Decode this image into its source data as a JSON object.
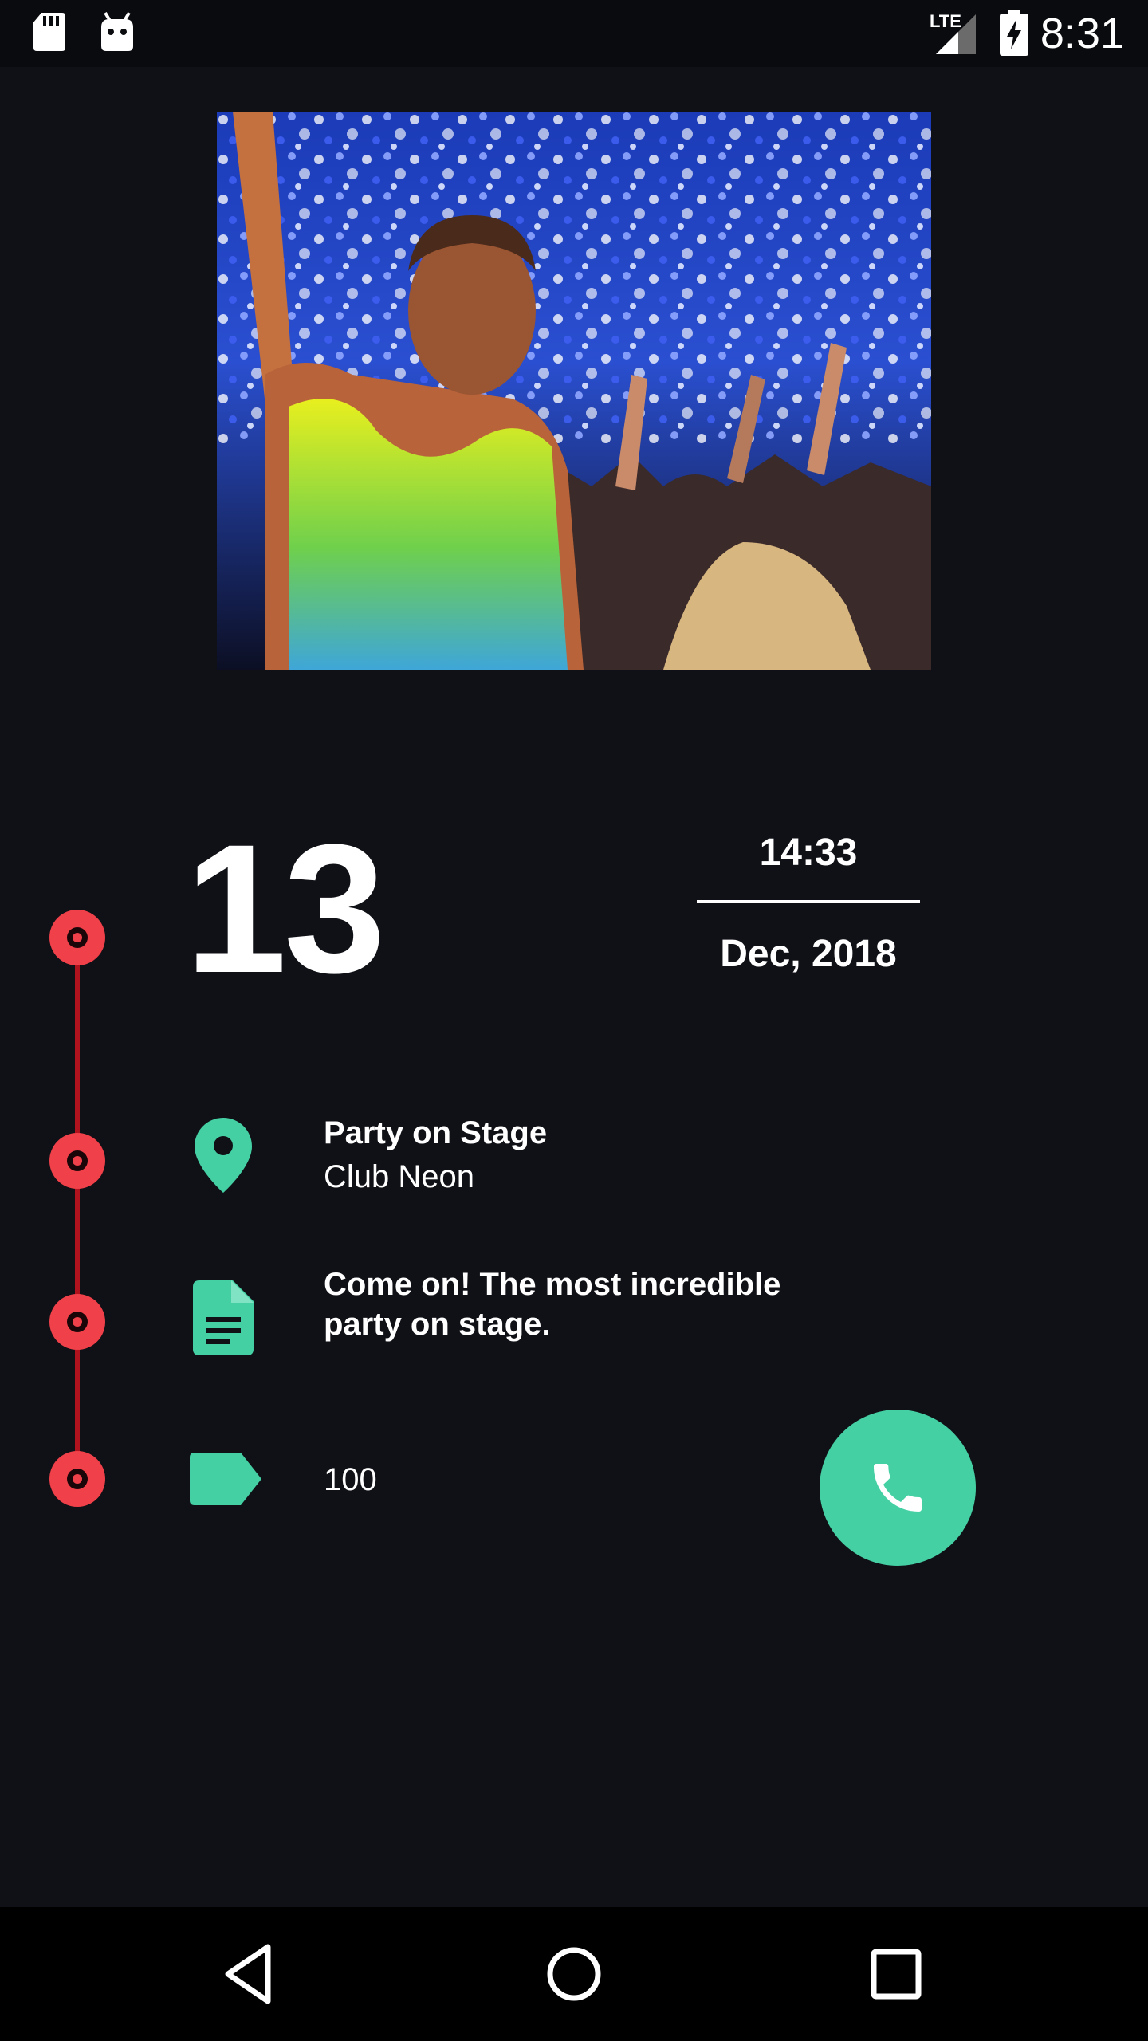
{
  "status_bar": {
    "time": "8:31",
    "network_label": "LTE",
    "icons": [
      "sd-card-icon",
      "android-debug-icon",
      "signal-icon",
      "battery-charging-icon"
    ]
  },
  "event": {
    "day": "13",
    "time": "14:33",
    "month_year": "Dec, 2018",
    "title": "Party on Stage",
    "venue": "Club Neon",
    "description": "Come on! The most incredible party on stage.",
    "tag_value": "100"
  },
  "colors": {
    "background": "#101116",
    "accent": "#45d0a4",
    "timeline": "#f0404a"
  },
  "fab": {
    "icon": "phone-icon"
  },
  "nav_bar": {
    "icons": [
      "back-icon",
      "home-icon",
      "recents-icon"
    ]
  }
}
